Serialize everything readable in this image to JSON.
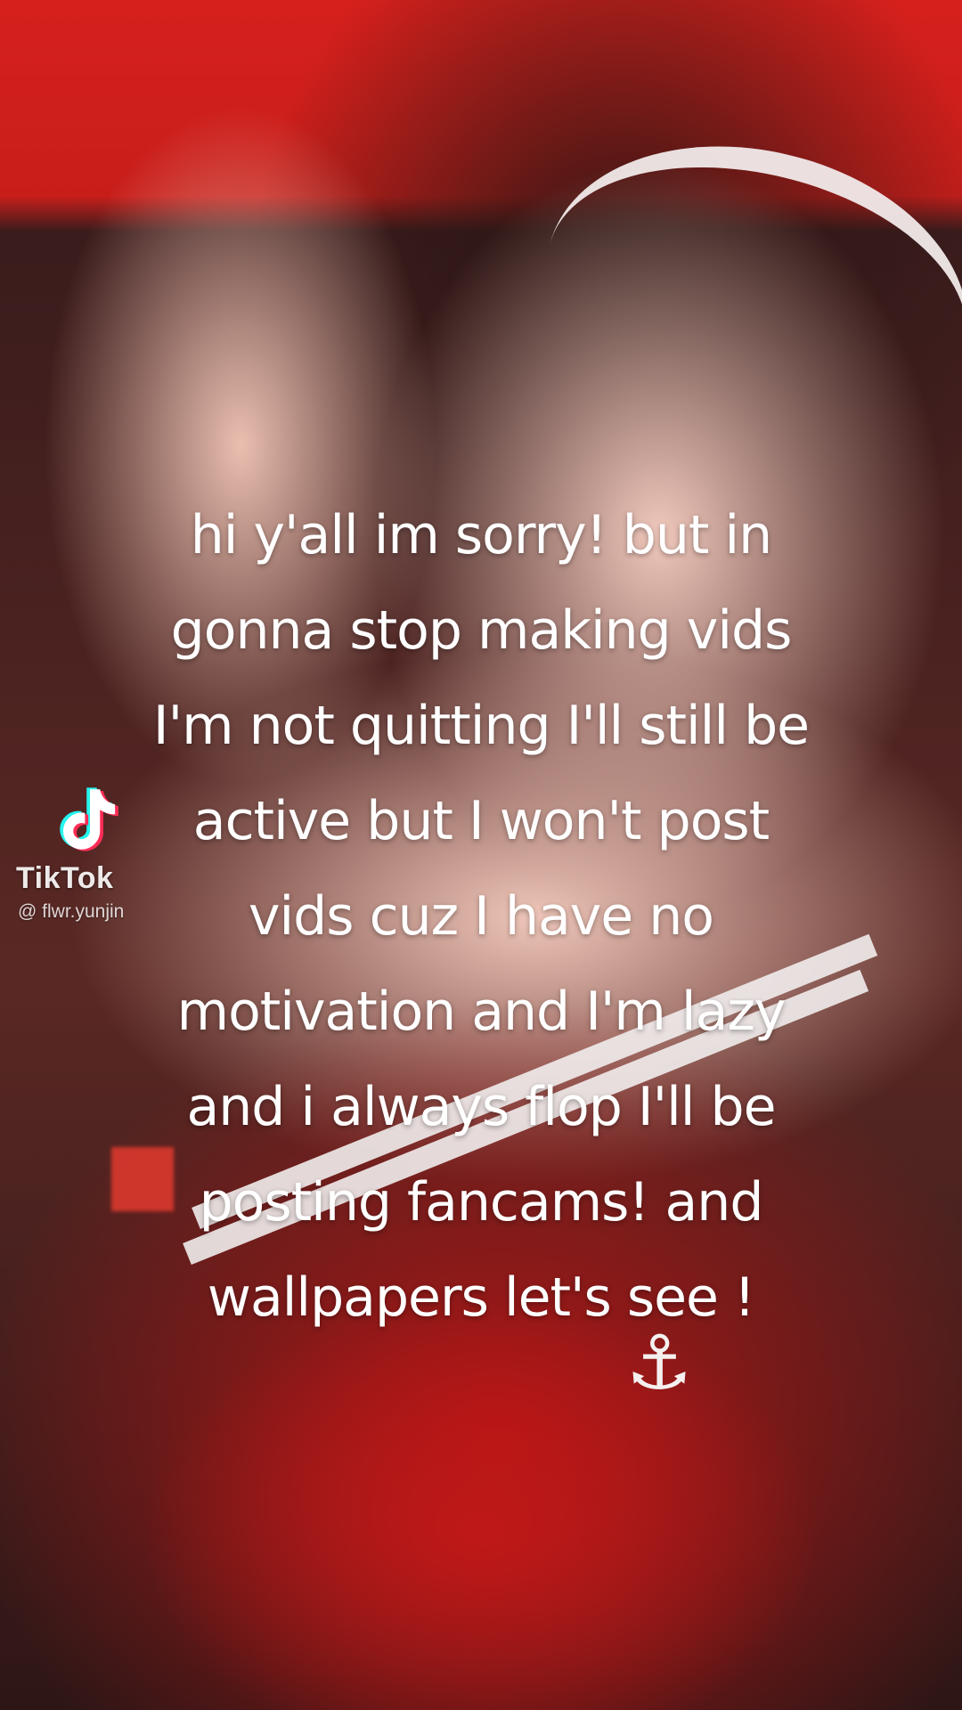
{
  "watermark": {
    "logo_icon": "tiktok-logo-icon",
    "brand": "TikTok",
    "handle": "@ flwr.yunjin"
  },
  "caption": {
    "lines": [
      "hi y'all im sorry! but in",
      "gonna stop making vids",
      "I'm not quitting I'll still be",
      "active but I won't post",
      "vids cuz I have no",
      "motivation and I'm lazy",
      "and i always flop I'll be",
      "posting fancams! and",
      "wallpapers let's see !"
    ]
  },
  "colors": {
    "background_red": "#c81e1a",
    "text": "#ffffff"
  }
}
